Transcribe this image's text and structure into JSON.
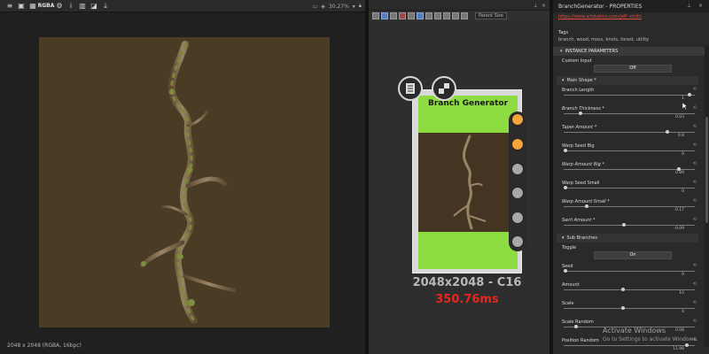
{
  "view2d": {
    "zoom": "30.27%",
    "status": "2048 x 2048 (RGBA, 16bpc)",
    "toolbar_icons": [
      "layers-icon",
      "image-icon",
      "checker-icon",
      "rgba-channel-icon",
      "settings-icon",
      "info-icon",
      "histogram-icon",
      "display-icon",
      "export-icon"
    ],
    "rgba_label": "RGBA"
  },
  "graph": {
    "parent_size_label": "Parent Size",
    "node": {
      "title": "Branch Generator",
      "resolution": "2048x2048 - C16",
      "time": "350.76ms",
      "ports": [
        "out",
        "out",
        "in",
        "in",
        "in",
        "in"
      ]
    }
  },
  "props": {
    "title": "BranchGenerator - PROPERTIES",
    "url": "https://www.artstation.com/jeff_smith",
    "tags_label": "Tags",
    "tags_value": "branch, wood, moss, knots, forest, utility",
    "instance_params": "INSTANCE PARAMETERS",
    "custom_input_label": "Custom Input",
    "custom_input_value": "Off",
    "main_shape": "Main Shape *",
    "params": [
      {
        "label": "Branch Length",
        "value": "1",
        "fraction": 0.97,
        "italic": false
      },
      {
        "label": "Branch Thickness *",
        "value": "0.03",
        "fraction": 0.12,
        "italic": true
      },
      {
        "label": "Taper Amount *",
        "value": "0.8",
        "fraction": 0.8,
        "italic": true
      },
      {
        "label": "Warp Seed Big",
        "value": "0",
        "fraction": 0.0,
        "italic": false
      },
      {
        "label": "Warp Amount Big *",
        "value": "0.89",
        "fraction": 0.89,
        "italic": true
      },
      {
        "label": "Warp Seed Small",
        "value": "0",
        "fraction": 0.0,
        "italic": false
      },
      {
        "label": "Warp Amount Small *",
        "value": "0.17",
        "fraction": 0.17,
        "italic": true
      },
      {
        "label": "Swirl Amount *",
        "value": "-0.09",
        "fraction": 0.46,
        "italic": true
      }
    ],
    "sub_branches": "Sub Branches",
    "toggle_label": "Toggle",
    "toggle_value": "On",
    "sub_params": [
      {
        "label": "Seed",
        "value": "0",
        "fraction": 0.0
      },
      {
        "label": "Amount",
        "value": "10",
        "fraction": 0.45
      },
      {
        "label": "Scale",
        "value": "4",
        "fraction": 0.45
      },
      {
        "label": "Scale Random",
        "value": "0.08",
        "fraction": 0.08
      },
      {
        "label": "Position Random",
        "value": "11.98",
        "fraction": 0.95
      }
    ],
    "activate_title": "Activate Windows",
    "activate_sub": "Go to Settings to activate Windows."
  }
}
